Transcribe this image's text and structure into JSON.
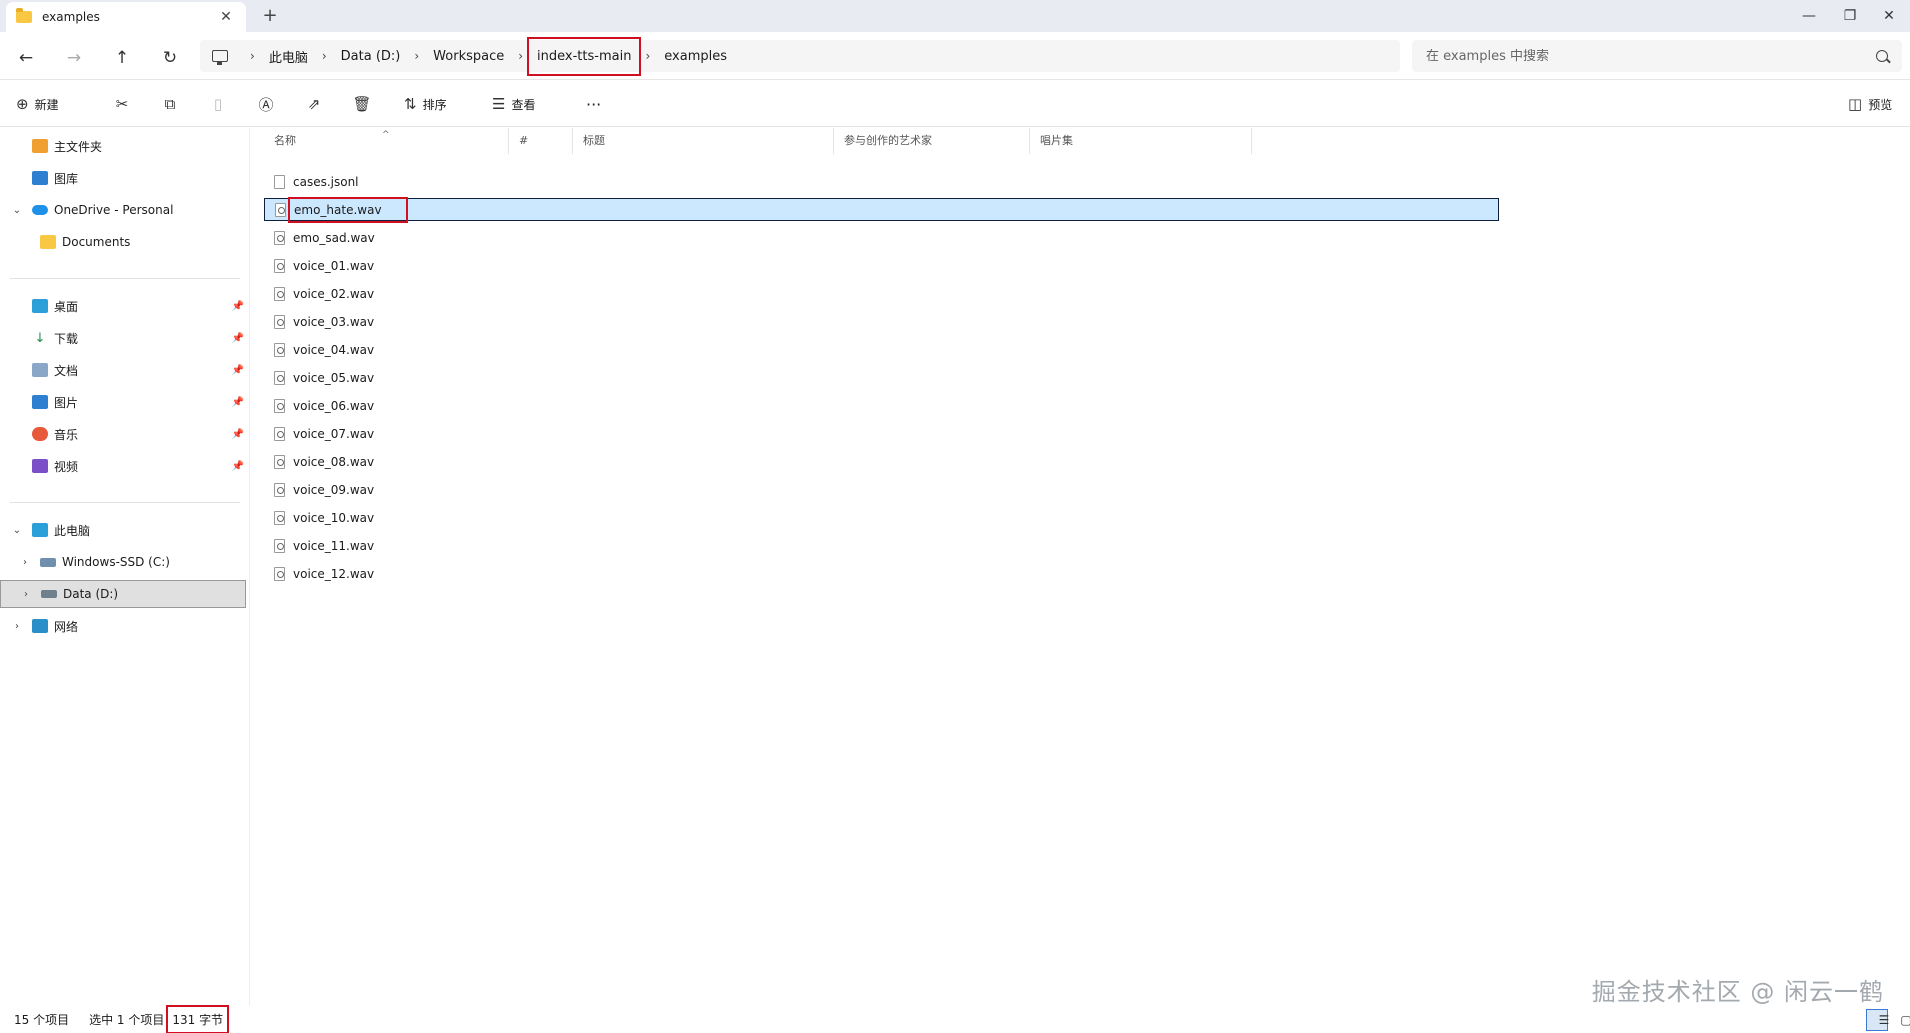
{
  "window": {
    "tab_title": "examples",
    "tab_close": "✕",
    "new_tab": "+",
    "minimize": "—",
    "restore": "❐",
    "close": "✕"
  },
  "nav": {
    "back": "←",
    "forward": "→",
    "up": "↑",
    "refresh": "↻"
  },
  "breadcrumb": {
    "items": [
      "此电脑",
      "Data (D:)",
      "Workspace",
      "index-tts-main",
      "examples"
    ],
    "separator": "›"
  },
  "search": {
    "placeholder": "在 examples 中搜索"
  },
  "toolbar": {
    "new_label": "新建",
    "sort_label": "排序",
    "view_label": "查看",
    "more_label": "···",
    "preview_label": "预览"
  },
  "sidebar": {
    "quick": [
      {
        "label": "主文件夹",
        "icon": "home-icon"
      },
      {
        "label": "图库",
        "icon": "gallery-icon"
      },
      {
        "label": "OneDrive - Personal",
        "icon": "onedrive-icon"
      },
      {
        "label": "Documents",
        "icon": "folder-icon"
      }
    ],
    "pinned": [
      {
        "label": "桌面",
        "icon": "desktop-icon"
      },
      {
        "label": "下载",
        "icon": "download-icon"
      },
      {
        "label": "文档",
        "icon": "document-icon"
      },
      {
        "label": "图片",
        "icon": "pictures-icon"
      },
      {
        "label": "音乐",
        "icon": "music-icon"
      },
      {
        "label": "视频",
        "icon": "video-icon"
      }
    ],
    "devices": [
      {
        "label": "此电脑",
        "icon": "pc-icon"
      },
      {
        "label": "Windows-SSD (C:)",
        "icon": "drive-icon"
      },
      {
        "label": "Data (D:)",
        "icon": "drive-icon"
      },
      {
        "label": "网络",
        "icon": "network-icon"
      }
    ]
  },
  "columns": [
    "名称",
    "#",
    "标题",
    "参与创作的艺术家",
    "唱片集"
  ],
  "files": [
    "cases.jsonl",
    "emo_hate.wav",
    "emo_sad.wav",
    "voice_01.wav",
    "voice_02.wav",
    "voice_03.wav",
    "voice_04.wav",
    "voice_05.wav",
    "voice_06.wav",
    "voice_07.wav",
    "voice_08.wav",
    "voice_09.wav",
    "voice_10.wav",
    "voice_11.wav",
    "voice_12.wav"
  ],
  "status": {
    "count": "15 个项目",
    "selected": "选中 1 个项目",
    "size": "131 字节"
  },
  "watermark": "掘金技术社区 @ 闲云一鹤",
  "colors": {
    "accent": "#0067c0",
    "selection": "#cce8ff",
    "highlight_box": "#d01020"
  }
}
